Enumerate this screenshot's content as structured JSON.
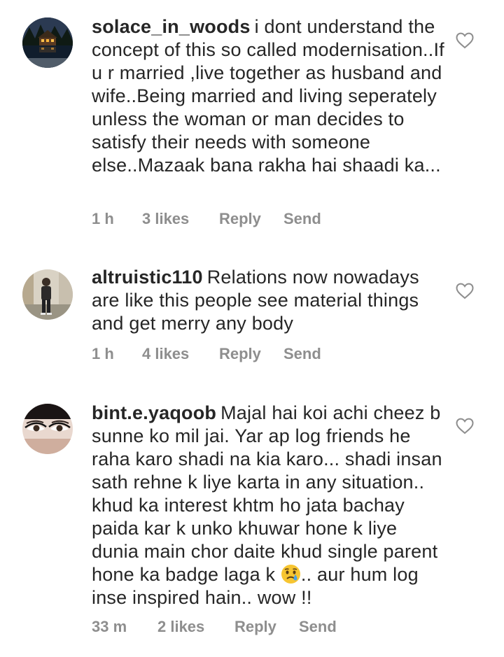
{
  "comments": [
    {
      "username": "solace_in_woods",
      "text": "i dont understand the concept of this so called modernisation..If u r married ,live together as husband and wife..Being married and living seperately unless the woman or man decides to satisfy their needs with someone else..Mazaak bana rakha hai shaadi ka...",
      "time": "1 h",
      "likes": "3 likes",
      "reply": "Reply",
      "send": "Send",
      "avatar_icon": "avatar-cabin-lake-night",
      "like_icon": "heart-outline-icon"
    },
    {
      "username": "altruistic110",
      "text": "Relations now nowadays are  like this people see material things and get merry any body",
      "time": "1 h",
      "likes": "4 likes",
      "reply": "Reply",
      "send": "Send",
      "avatar_icon": "avatar-person-standing",
      "like_icon": "heart-outline-icon"
    },
    {
      "username": "bint.e.yaqoob",
      "text_before_emoji": "Majal hai koi achi cheez b sunne ko mil jai. Yar ap log friends he raha karo shadi na kia karo... shadi insan sath rehne k liye karta in any situation.. khud ka interest khtm ho jata bachay paida kar k unko khuwar hone k liye dunia main chor daite khud single parent hone ka badge laga k",
      "emoji": "crying-face-emoji",
      "text_after_emoji": ".. aur hum log inse inspired hain.. wow !!",
      "time": "33 m",
      "likes": "2 likes",
      "reply": "Reply",
      "send": "Send",
      "avatar_icon": "avatar-woman-eyes",
      "like_icon": "heart-outline-icon"
    }
  ],
  "colors": {
    "text": "#262626",
    "meta": "#8e8e8e",
    "heart_outline": "#8e8e8e"
  }
}
